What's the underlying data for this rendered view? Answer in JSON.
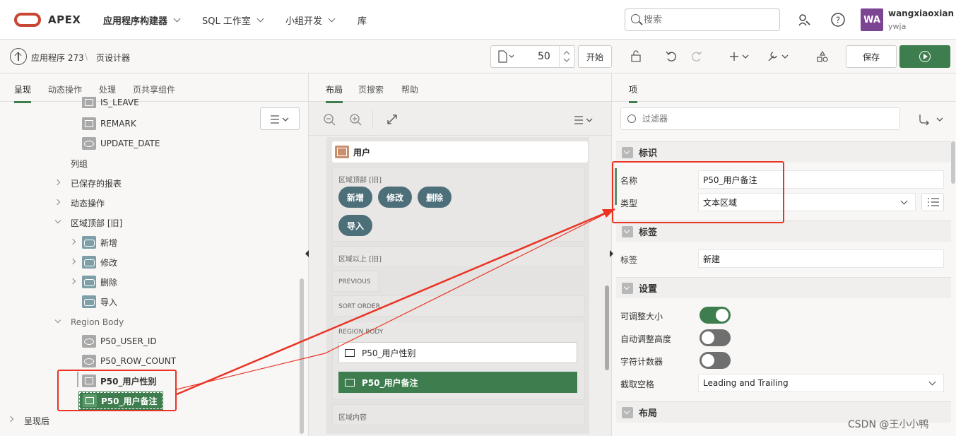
{
  "app": {
    "logo_text": "APEX",
    "nav": [
      "应用程序构建器",
      "SQL 工作室",
      "小组开发",
      "库"
    ],
    "search_placeholder": "搜索",
    "user_initials": "WA",
    "user_name": "wangxiaoxian",
    "user_workspace": "ywja"
  },
  "breadcrumb": {
    "app": "应用程序 273",
    "page": "页设计器"
  },
  "toolbar": {
    "page_number": "50",
    "go_label": "开始",
    "save_label": "保存"
  },
  "left": {
    "tabs": [
      "呈现",
      "动态操作",
      "处理",
      "页共享组件"
    ],
    "tree": [
      {
        "label": "IS_LEAVE",
        "icon": "field"
      },
      {
        "label": "REMARK",
        "icon": "field"
      },
      {
        "label": "UPDATE_DATE",
        "icon": "hidden"
      },
      {
        "label": "列组",
        "icon": "none"
      },
      {
        "label": "已保存的报表",
        "icon": "none"
      },
      {
        "label": "动态操作",
        "icon": "none"
      },
      {
        "label": "区域顶部 [旧]",
        "icon": "none"
      },
      {
        "label": "新增",
        "icon": "button"
      },
      {
        "label": "修改",
        "icon": "button"
      },
      {
        "label": "删除",
        "icon": "button"
      },
      {
        "label": "导入",
        "icon": "button"
      },
      {
        "label": "Region Body",
        "icon": "none"
      },
      {
        "label": "P50_USER_ID",
        "icon": "hidden"
      },
      {
        "label": "P50_ROW_COUNT",
        "icon": "hidden"
      },
      {
        "label": "P50_用户性别",
        "icon": "field"
      },
      {
        "label": "P50_用户备注",
        "icon": "field"
      },
      {
        "label": "呈现后",
        "icon": "none"
      }
    ]
  },
  "middle": {
    "tabs": [
      "布局",
      "页搜索",
      "帮助"
    ],
    "region_title": "用户",
    "slots": {
      "top": "区域顶部 [旧]",
      "above": "区域以上 [旧]",
      "previous": "PREVIOUS",
      "sort": "SORT ORDER",
      "body": "REGION BODY",
      "content": "区域内容"
    },
    "buttons": [
      "新增",
      "修改",
      "删除",
      "导入"
    ],
    "items": [
      "P50_用户性别",
      "P50_用户备注"
    ]
  },
  "right": {
    "tab": "项",
    "filter_placeholder": "过滤器",
    "sections": {
      "identification": "标识",
      "label": "标签",
      "settings": "设置",
      "layout": "布局"
    },
    "props": {
      "name_label": "名称",
      "name_value": "P50_用户备注",
      "type_label": "类型",
      "type_value": "文本区域",
      "label_label": "标签",
      "label_value": "新建",
      "resizable_label": "可调整大小",
      "autoheight_label": "自动调整高度",
      "counter_label": "字符计数器",
      "trim_label": "截取空格",
      "trim_value": "Leading and Trailing"
    },
    "toggles": {
      "resizable": true,
      "autoheight": false,
      "counter": false
    }
  },
  "watermark": "CSDN @王小小鸭",
  "colors": {
    "accent": "#3e7d4e",
    "annotation": "#ea3323",
    "brand": "#c74634",
    "avatar": "#7b4594"
  }
}
